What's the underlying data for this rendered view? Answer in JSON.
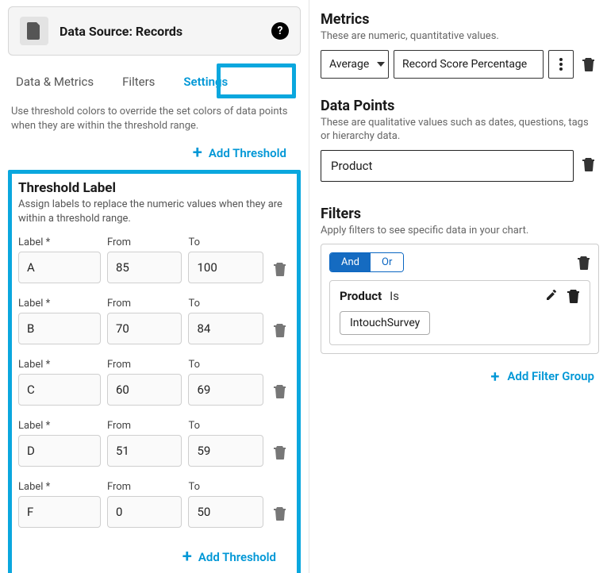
{
  "data_source": {
    "label": "Data Source: Records"
  },
  "tabs": {
    "data_metrics": "Data & Metrics",
    "filters": "Filters",
    "settings": "Settings"
  },
  "threshold_colors_desc": "Use threshold colors to override the set colors of data points when they are within the threshold range.",
  "add_threshold_label": "Add Threshold",
  "threshold_label_section": {
    "title": "Threshold Label",
    "desc": "Assign labels to replace the numeric values when they are within a threshold range."
  },
  "field_labels": {
    "label": "Label *",
    "from": "From",
    "to": "To"
  },
  "thresholds": [
    {
      "label": "A",
      "from": "85",
      "to": "100"
    },
    {
      "label": "B",
      "from": "70",
      "to": "84"
    },
    {
      "label": "C",
      "from": "60",
      "to": "69"
    },
    {
      "label": "D",
      "from": "51",
      "to": "59"
    },
    {
      "label": "F",
      "from": "0",
      "to": "50"
    }
  ],
  "metrics": {
    "title": "Metrics",
    "desc": "These are numeric, quantitative values.",
    "agg": "Average",
    "value": "Record Score Percentage"
  },
  "data_points": {
    "title": "Data Points",
    "desc": "These are qualitative values such as dates, questions, tags or hierarchy data.",
    "value": "Product"
  },
  "filters": {
    "title": "Filters",
    "desc": "Apply filters to see specific data in your chart.",
    "and": "And",
    "or": "Or",
    "rule_field": "Product",
    "rule_op": "Is",
    "chip": "IntouchSurvey",
    "add_group": "Add Filter Group"
  }
}
